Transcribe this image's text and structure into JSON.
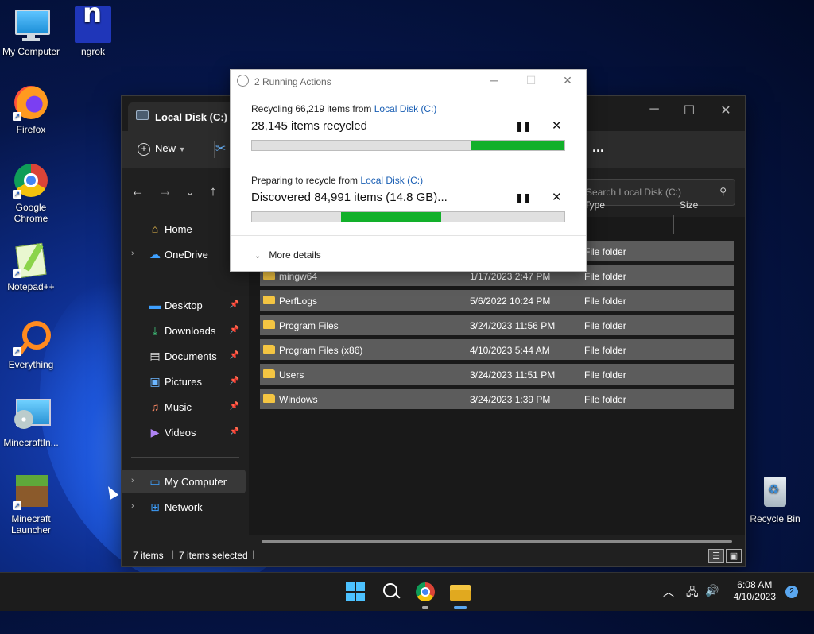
{
  "desktop": {
    "icons": [
      {
        "label": "My Computer"
      },
      {
        "label": "ngrok"
      },
      {
        "label": "Firefox"
      },
      {
        "label": "Google Chrome"
      },
      {
        "label": "Notepad++"
      },
      {
        "label": "Everything"
      },
      {
        "label": "MinecraftIn..."
      },
      {
        "label": "Minecraft Launcher"
      },
      {
        "label": "Recycle Bin"
      }
    ]
  },
  "explorer": {
    "tab_title": "Local Disk (C:)",
    "toolbar": {
      "new_label": "New",
      "more_label": "..."
    },
    "search_placeholder": "Search Local Disk (C:)",
    "sidebar": {
      "home": "Home",
      "onedrive": "OneDrive",
      "desktop": "Desktop",
      "downloads": "Downloads",
      "documents": "Documents",
      "pictures": "Pictures",
      "music": "Music",
      "videos": "Videos",
      "my_computer": "My Computer",
      "network": "Network"
    },
    "columns": {
      "type": "Type",
      "size": "Size"
    },
    "rows": [
      {
        "name": "",
        "date": "",
        "type": "File folder"
      },
      {
        "name": "mingw64",
        "date": "1/17/2023 2:47 PM",
        "type": "File folder"
      },
      {
        "name": "PerfLogs",
        "date": "5/6/2022 10:24 PM",
        "type": "File folder"
      },
      {
        "name": "Program Files",
        "date": "3/24/2023 11:56 PM",
        "type": "File folder"
      },
      {
        "name": "Program Files (x86)",
        "date": "4/10/2023 5:44 AM",
        "type": "File folder"
      },
      {
        "name": "Users",
        "date": "3/24/2023 11:51 PM",
        "type": "File folder"
      },
      {
        "name": "Windows",
        "date": "3/24/2023 1:39 PM",
        "type": "File folder"
      }
    ],
    "status": {
      "count": "7 items",
      "selected": "7 items selected"
    }
  },
  "dialog": {
    "title": "2 Running Actions",
    "op1": {
      "sub_prefix": "Recycling 66,219 items from ",
      "sub_link": "Local Disk (C:)",
      "main": "28,145 items recycled",
      "progress_start": 0.0,
      "progress_end": 1.0,
      "gray_portion": 0.695
    },
    "op2": {
      "sub_prefix": "Preparing to recycle from ",
      "sub_link": "Local Disk (C:)",
      "main": "Discovered 84,991 items (14.8 GB)..."
    },
    "more_details": "More details"
  },
  "taskbar": {
    "time": "6:08 AM",
    "date": "4/10/2023",
    "notifications": "2"
  },
  "colors": {
    "progress_green": "#12b02a",
    "accent": "#1a5fb4"
  }
}
